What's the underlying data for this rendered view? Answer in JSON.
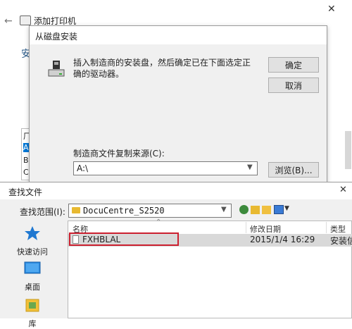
{
  "background_window": {
    "back_arrow": "←",
    "title": "添加打印机",
    "close": "✕",
    "heading_partial": "安",
    "list_letters": [
      "厂",
      "A",
      "B",
      "C"
    ]
  },
  "disk_dialog": {
    "title": "从磁盘安装",
    "message": "插入制造商的安装盘，然后确定已在下面选定正确的驱动器。",
    "ok_label": "确定",
    "cancel_label": "取消",
    "source_label": "制造商文件复制来源(C):",
    "source_value": "A:\\",
    "browse_label": "浏览(B)..."
  },
  "browse_dialog": {
    "title": "查找文件",
    "close": "✕",
    "lookin_label": "查找范围(I):",
    "lookin_value": "DocuCentre_S2520",
    "places": [
      {
        "label": "快速访问"
      },
      {
        "label": "桌面"
      },
      {
        "label": "库"
      }
    ],
    "columns": {
      "name": "名称",
      "date": "修改日期",
      "type": "类型"
    },
    "files": [
      {
        "name": "FXHBLAL",
        "date": "2015/1/4 16:29",
        "type": "安装信息"
      }
    ]
  },
  "colors": {
    "highlight": "#cc2030",
    "selection": "#d9d9d9",
    "accent": "#0078d7"
  }
}
